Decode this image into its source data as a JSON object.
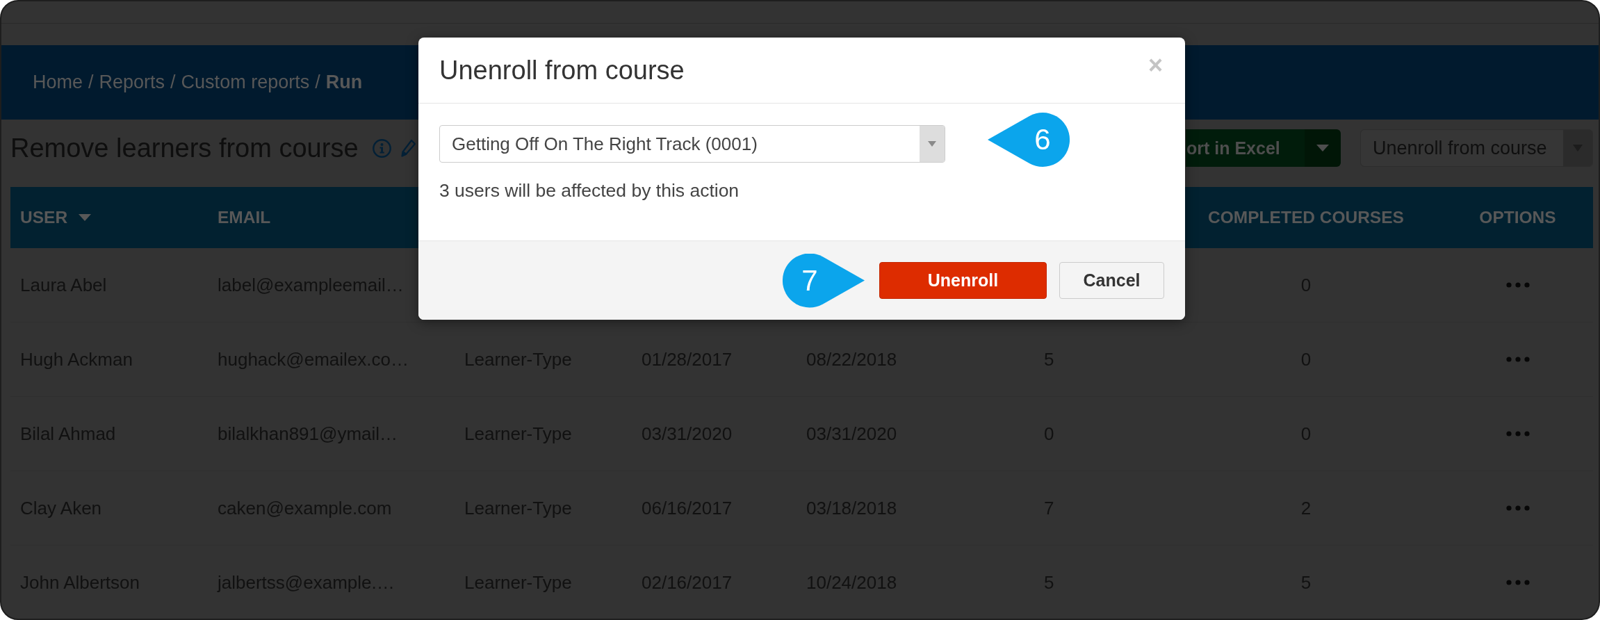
{
  "breadcrumb": {
    "separator": "/",
    "items": [
      {
        "label": "Home",
        "current": false
      },
      {
        "label": "Reports",
        "current": false
      },
      {
        "label": "Custom reports",
        "current": false
      },
      {
        "label": "Run",
        "current": true
      }
    ]
  },
  "page": {
    "title": "Remove learners from course",
    "export_button": {
      "label": "ort in Excel"
    },
    "action_select": {
      "value": "Unenroll from course"
    }
  },
  "table": {
    "columns": [
      {
        "label": "USER",
        "sorted": true
      },
      {
        "label": "EMAIL",
        "sorted": false
      },
      null,
      null,
      null,
      null,
      {
        "label": "COMPLETED COURSES",
        "sorted": false
      },
      {
        "label": "OPTIONS",
        "sorted": false
      }
    ],
    "rows": [
      {
        "cells": [
          "Laura Abel",
          "label@exampleemail…",
          null,
          null,
          null,
          null,
          "0"
        ]
      },
      {
        "cells": [
          "Hugh Ackman",
          "hughack@emailex.co…",
          "Learner-Type",
          "01/28/2017",
          "08/22/2018",
          "5",
          "0"
        ]
      },
      {
        "cells": [
          "Bilal Ahmad",
          "bilalkhan891@ymail…",
          "Learner-Type",
          "03/31/2020",
          "03/31/2020",
          "0",
          "0"
        ]
      },
      {
        "cells": [
          "Clay Aken",
          "caken@example.com",
          "Learner-Type",
          "06/16/2017",
          "03/18/2018",
          "7",
          "2"
        ]
      },
      {
        "cells": [
          "John Albertson",
          "jalbertss@example.…",
          "Learner-Type",
          "02/16/2017",
          "10/24/2018",
          "5",
          "5"
        ]
      }
    ]
  },
  "modal": {
    "title": "Unenroll from course",
    "close": "×",
    "course_select": {
      "value": "Getting Off On The Right Track (0001)",
      "callout": "6"
    },
    "note": "3 users will be affected by this action",
    "buttons": [
      {
        "label": "Unenroll",
        "kind": "primary",
        "callout": "7"
      },
      {
        "label": "Cancel",
        "kind": "secondary"
      }
    ]
  }
}
